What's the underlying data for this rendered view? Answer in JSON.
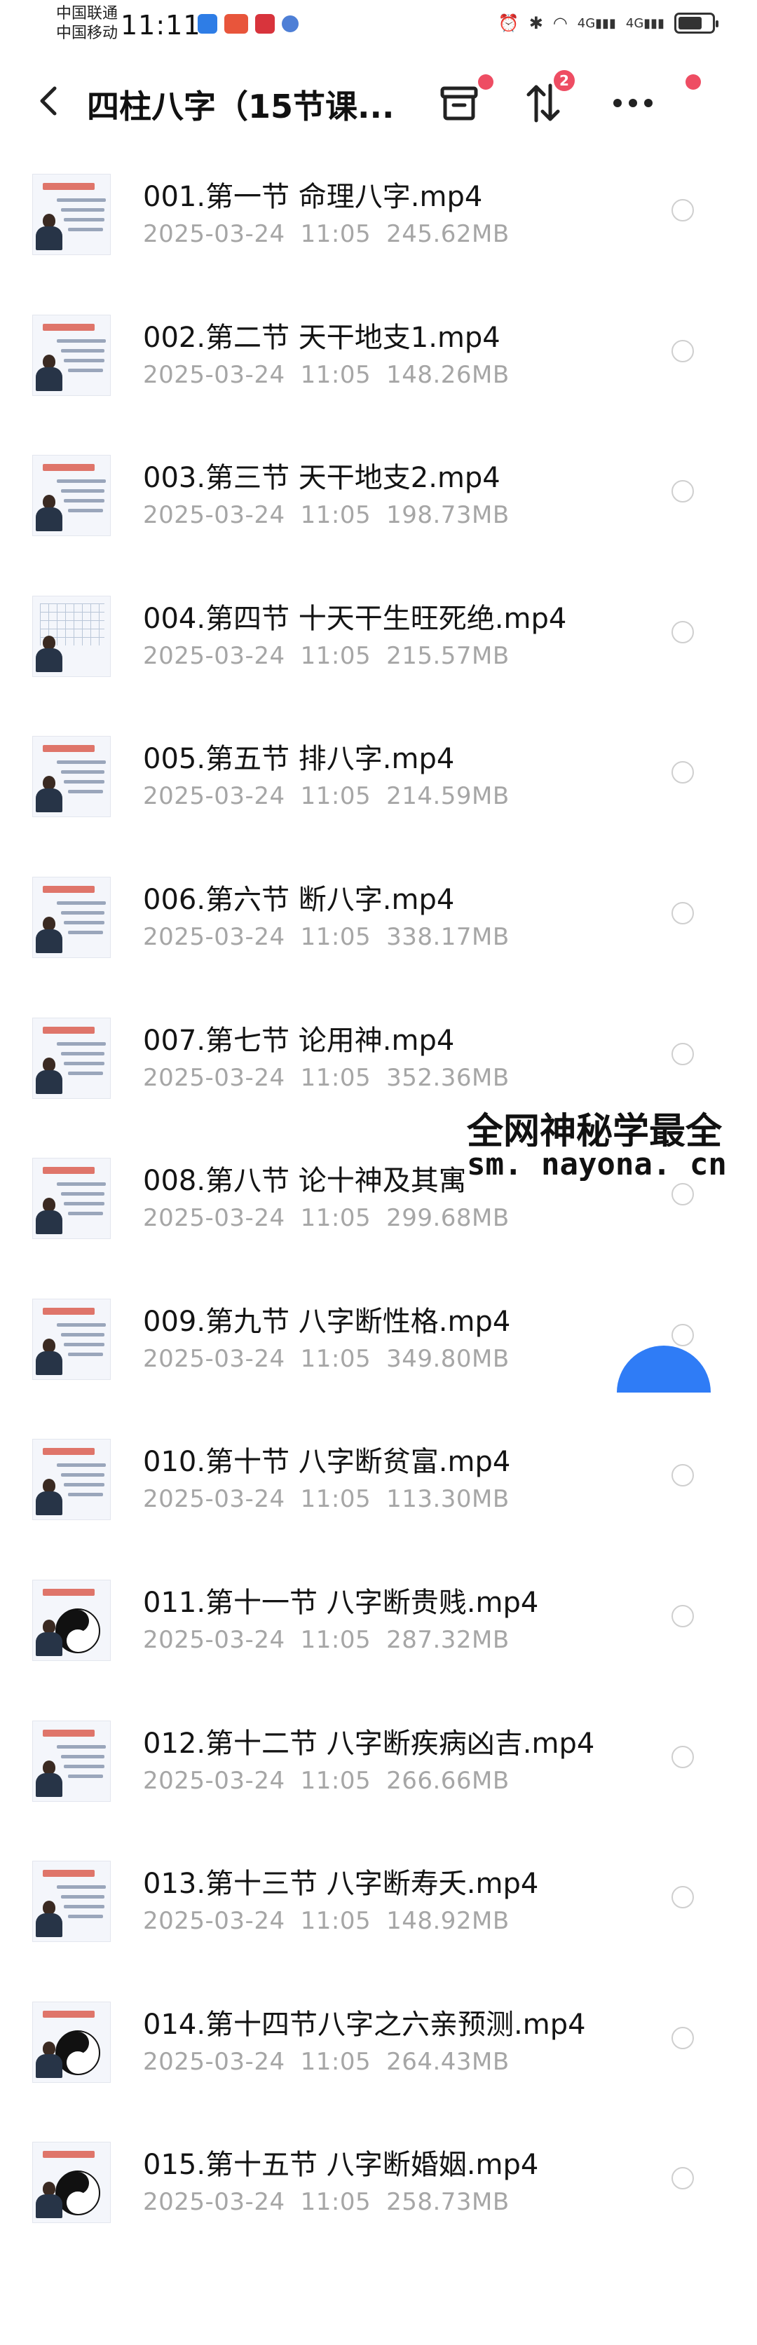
{
  "status_bar": {
    "carrier1": "中国联通",
    "carrier2": "中国移动",
    "time": "11:11",
    "signal_label_1": "4G",
    "signal_label_2": "4G"
  },
  "header": {
    "title": "四柱八字（15节课...",
    "sort_badge": "2"
  },
  "files": [
    {
      "name": "001.第一节 命理八字.mp4",
      "date": "2025-03-24",
      "time": "11:05",
      "size": "245.62MB",
      "thumb": "slide"
    },
    {
      "name": "002.第二节 天干地支1.mp4",
      "date": "2025-03-24",
      "time": "11:05",
      "size": "148.26MB",
      "thumb": "slide"
    },
    {
      "name": "003.第三节 天干地支2.mp4",
      "date": "2025-03-24",
      "time": "11:05",
      "size": "198.73MB",
      "thumb": "slide"
    },
    {
      "name": "004.第四节 十天干生旺死绝.mp4",
      "date": "2025-03-24",
      "time": "11:05",
      "size": "215.57MB",
      "thumb": "grid"
    },
    {
      "name": "005.第五节 排八字.mp4",
      "date": "2025-03-24",
      "time": "11:05",
      "size": "214.59MB",
      "thumb": "slide"
    },
    {
      "name": "006.第六节 断八字.mp4",
      "date": "2025-03-24",
      "time": "11:05",
      "size": "338.17MB",
      "thumb": "slide"
    },
    {
      "name": "007.第七节 论用神.mp4",
      "date": "2025-03-24",
      "time": "11:05",
      "size": "352.36MB",
      "thumb": "slide"
    },
    {
      "name": "008.第八节 论十神及其寓",
      "date": "2025-03-24",
      "time": "11:05",
      "size": "299.68MB",
      "thumb": "slide"
    },
    {
      "name": "009.第九节 八字断性格.mp4",
      "date": "2025-03-24",
      "time": "11:05",
      "size": "349.80MB",
      "thumb": "slide"
    },
    {
      "name": "010.第十节 八字断贫富.mp4",
      "date": "2025-03-24",
      "time": "11:05",
      "size": "113.30MB",
      "thumb": "slide"
    },
    {
      "name": "011.第十一节 八字断贵贱.mp4",
      "date": "2025-03-24",
      "time": "11:05",
      "size": "287.32MB",
      "thumb": "yinyang"
    },
    {
      "name": "012.第十二节 八字断疾病凶吉.mp4",
      "date": "2025-03-24",
      "time": "11:05",
      "size": "266.66MB",
      "thumb": "slide"
    },
    {
      "name": "013.第十三节 八字断寿夭.mp4",
      "date": "2025-03-24",
      "time": "11:05",
      "size": "148.92MB",
      "thumb": "slide"
    },
    {
      "name": "014.第十四节八字之六亲预测.mp4",
      "date": "2025-03-24",
      "time": "11:05",
      "size": "264.43MB",
      "thumb": "yinyang"
    },
    {
      "name": "015.第十五节 八字断婚姻.mp4",
      "date": "2025-03-24",
      "time": "11:05",
      "size": "258.73MB",
      "thumb": "yinyang"
    }
  ],
  "watermark": {
    "line1": "全网神秘学最全",
    "line2": "sm. nayona. cn"
  },
  "colors": {
    "accent": "#2f7cf6",
    "badge": "#ee4d63",
    "meta_text": "#a6a6a6"
  }
}
